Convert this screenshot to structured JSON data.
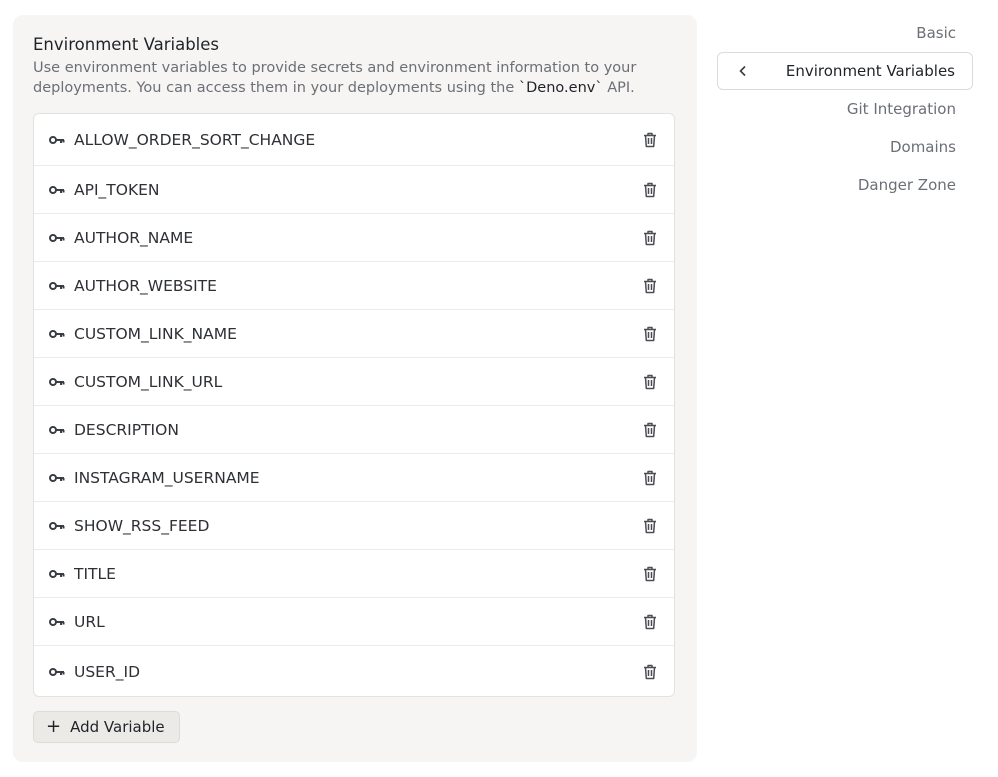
{
  "header": {
    "title": "Environment Variables",
    "desc_before": "Use environment variables to provide secrets and environment information to your deployments. You can access them in your deployments using the ",
    "desc_code": "`Deno.env`",
    "desc_after": " API."
  },
  "variables": [
    {
      "name": "ALLOW_ORDER_SORT_CHANGE"
    },
    {
      "name": "API_TOKEN"
    },
    {
      "name": "AUTHOR_NAME"
    },
    {
      "name": "AUTHOR_WEBSITE"
    },
    {
      "name": "CUSTOM_LINK_NAME"
    },
    {
      "name": "CUSTOM_LINK_URL"
    },
    {
      "name": "DESCRIPTION"
    },
    {
      "name": "INSTAGRAM_USERNAME"
    },
    {
      "name": "SHOW_RSS_FEED"
    },
    {
      "name": "TITLE"
    },
    {
      "name": "URL"
    },
    {
      "name": "USER_ID"
    }
  ],
  "add_button": {
    "label": "Add Variable",
    "icon": "plus-icon"
  },
  "nav": {
    "items": [
      {
        "label": "Basic",
        "active": false
      },
      {
        "label": "Environment Variables",
        "active": true
      },
      {
        "label": "Git Integration",
        "active": false
      },
      {
        "label": "Domains",
        "active": false
      },
      {
        "label": "Danger Zone",
        "active": false
      }
    ]
  },
  "icons": {
    "row_icon": "key-icon",
    "row_action": "trash-icon",
    "nav_active": "chevron-left-icon"
  },
  "colors": {
    "panel_bg": "#f6f5f3",
    "text_primary": "#1f2328",
    "text_muted": "#6b6f76",
    "border": "#dcdbd7"
  }
}
